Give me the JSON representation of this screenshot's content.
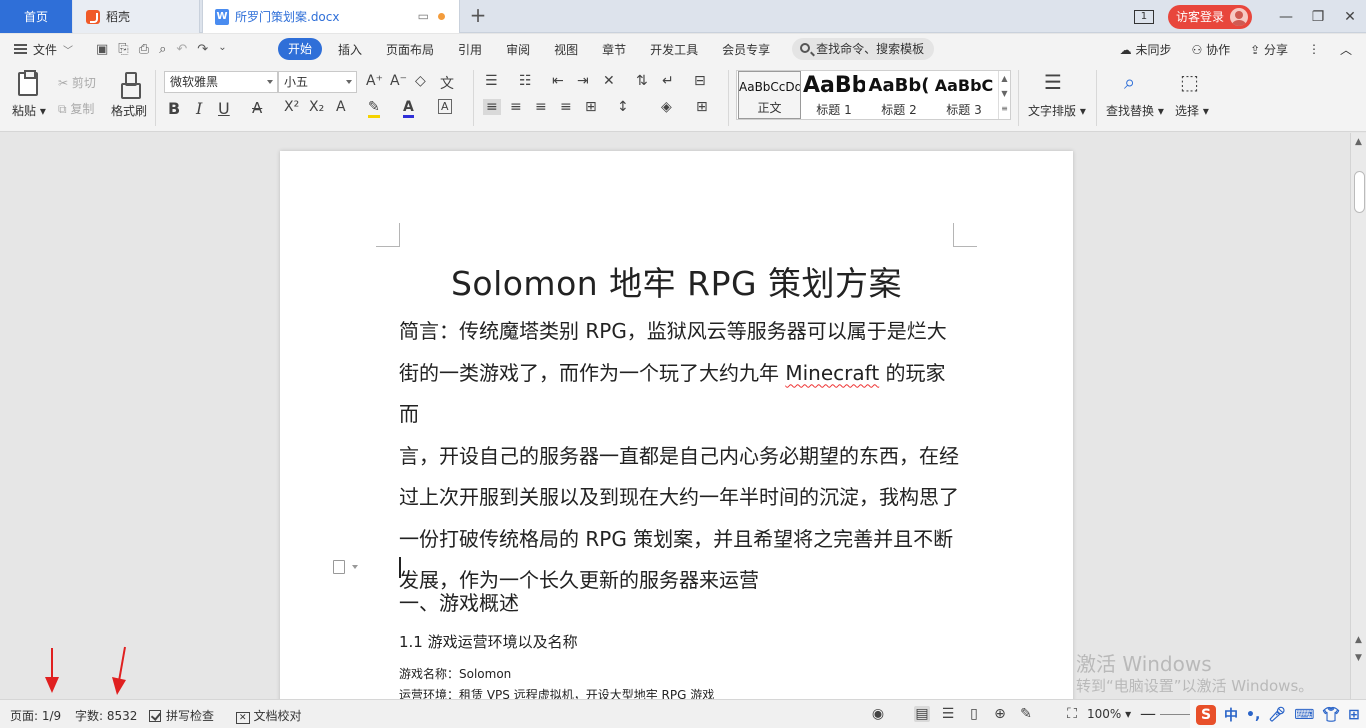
{
  "tabs": {
    "home": "首页",
    "daoke": "稻壳",
    "doc": "所罗门策划案.docx",
    "add": "+"
  },
  "titlebar": {
    "page_indicator": "1",
    "login": "访客登录",
    "minimize": "—",
    "restore": "❐",
    "close": "✕"
  },
  "menu": {
    "file": "文件",
    "items": [
      "开始",
      "插入",
      "页面布局",
      "引用",
      "审阅",
      "视图",
      "章节",
      "开发工具",
      "会员专享"
    ],
    "search": "查找命令、搜索模板",
    "unsync": "未同步",
    "collab": "协作",
    "share": "分享"
  },
  "ribbon": {
    "paste": "粘贴",
    "cut": "剪切",
    "copy": "复制",
    "format_painter": "格式刷",
    "font_name": "微软雅黑",
    "font_size": "小五",
    "text_layout": "文字排版",
    "find_replace": "查找替换",
    "select": "选择",
    "styles": [
      {
        "sample": "AaBbCcDd",
        "name": "正文"
      },
      {
        "sample": "AaBb",
        "name": "标题 1"
      },
      {
        "sample": "AaBb(",
        "name": "标题 2"
      },
      {
        "sample": "AaBbC",
        "name": "标题 3"
      }
    ]
  },
  "document": {
    "title": "Solomon 地牢 RPG 策划方案",
    "intro_lines": [
      "简言：传统魔塔类别 RPG，监狱风云等服务器可以属于是烂大",
      "街的一类游戏了，而作为一个玩了大约九年 ",
      "言，开设自己的服务器一直都是自己内心务必期望的东西，在经",
      "过上次开服到关服以及到现在大约一年半时间的沉淀，我构思了",
      "一份打破传统格局的 RPG 策划案，并且希望将之完善并且不断",
      "发展，作为一个长久更新的服务器来运营"
    ],
    "line2_word": "Minecraft",
    "line2_tail": " 的玩家而",
    "heading1": "一、游戏概述",
    "heading2": "1.1 游戏运营环境以及名称",
    "game_name": "游戏名称：Solomon",
    "environment": "运营环境：租赁 VPS 远程虚拟机，开设大型地牢 RPG 游戏"
  },
  "watermark": {
    "line1": "激活 Windows",
    "line2": "转到“电脑设置”以激活 Windows。"
  },
  "status": {
    "page": "页面: 1/9",
    "word_count": "字数: 8532",
    "spell_check": "拼写检查",
    "doc_proof": "文档校对",
    "zoom": "100%",
    "ime_lang": "中"
  },
  "colors": {
    "accent": "#2f6fd8",
    "login": "#e8463c",
    "arrow": "#e02020"
  }
}
